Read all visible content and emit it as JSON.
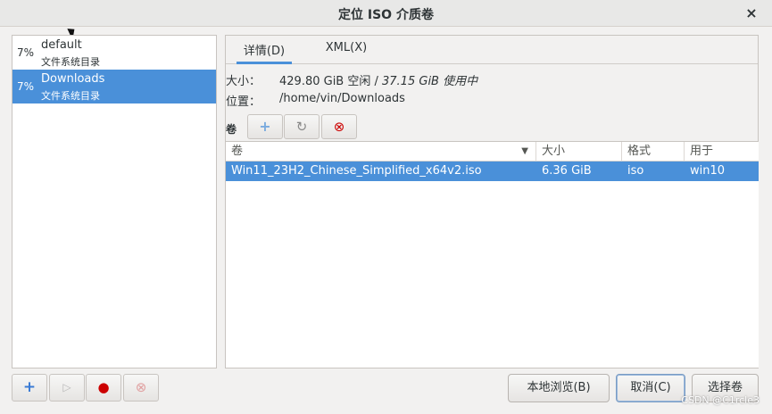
{
  "window": {
    "title": "定位 ISO 介质卷",
    "close_icon": "×"
  },
  "pools": [
    {
      "percent": "7%",
      "name": "default",
      "type": "文件系统目录",
      "selected": false
    },
    {
      "percent": "7%",
      "name": "Downloads",
      "type": "文件系统目录",
      "selected": true
    }
  ],
  "pool_toolbar": {
    "add_icon": "+",
    "start_icon": "▷",
    "stop_icon": "●",
    "delete_icon": "⊗"
  },
  "tabs": [
    {
      "label": "详情(D)",
      "active": true
    },
    {
      "label": "XML(X)",
      "active": false
    }
  ],
  "details": {
    "size_label": "大小：",
    "size_free": "429.80 GiB 空闲 / ",
    "size_used": "37.15 GiB 使用中",
    "location_label": "位置：",
    "location_value": "/home/vin/Downloads"
  },
  "volumes": {
    "label": "卷",
    "add_icon": "+",
    "refresh_icon": "↻",
    "delete_icon": "⊗",
    "columns": [
      "卷",
      "大小",
      "格式",
      "用于"
    ],
    "sort_icon": "▼",
    "rows": [
      {
        "name": "Win11_23H2_Chinese_Simplified_x64v2.iso",
        "size": "6.36 GiB",
        "format": "iso",
        "used_by": "win10"
      }
    ]
  },
  "buttons": {
    "browse_local": "本地浏览(B)",
    "cancel": "取消(C)",
    "choose": "选择卷"
  },
  "watermark": "CSDN @C1rcle3",
  "colors": {
    "selection": "#4a90d9",
    "delete_red": "#cc0000",
    "add_blue": "#3a7bd5"
  }
}
